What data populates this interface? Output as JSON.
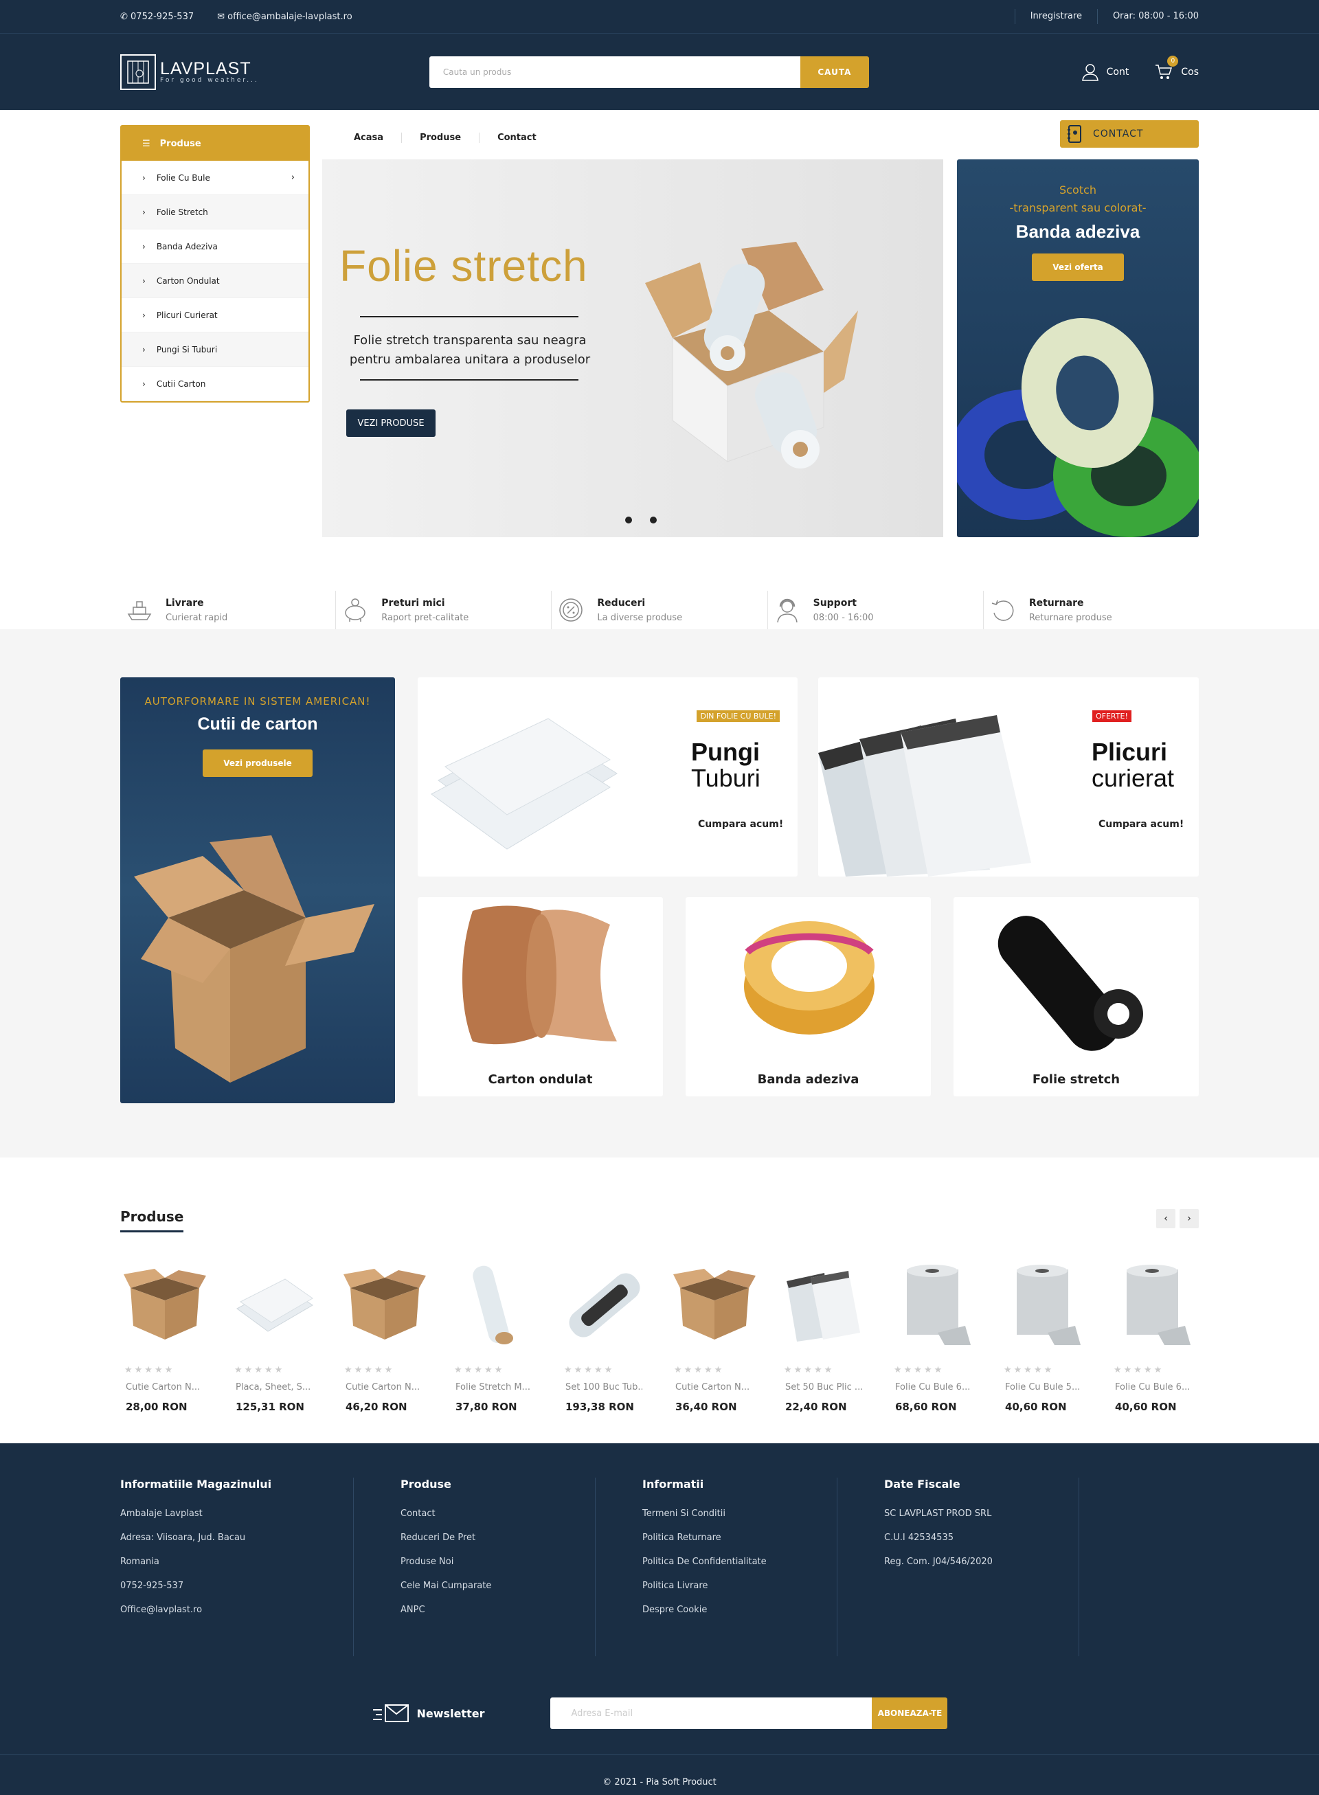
{
  "topbar": {
    "phone": "0752-925-537",
    "email": "office@ambalaje-lavplast.ro",
    "register": "Inregistrare",
    "hours": "Orar: 08:00 - 16:00"
  },
  "header": {
    "logo_title": "LAVPLAST",
    "logo_tagline": "For good weather...",
    "search_placeholder": "Cauta un produs",
    "search_button": "CAUTA",
    "account": "Cont",
    "cart": "Cos",
    "cart_count": "0"
  },
  "categories": {
    "title": "Produse",
    "items": [
      {
        "label": "Folie Cu Bule"
      },
      {
        "label": "Folie Stretch"
      },
      {
        "label": "Banda Adeziva"
      },
      {
        "label": "Carton Ondulat"
      },
      {
        "label": "Plicuri Curierat"
      },
      {
        "label": "Pungi Si Tuburi"
      },
      {
        "label": "Cutii Carton"
      }
    ]
  },
  "nav": {
    "items": [
      "Acasa",
      "Produse",
      "Contact"
    ],
    "contact_button": "CONTACT"
  },
  "hero": {
    "title": "Folie stretch",
    "text": "Folie stretch transparenta sau neagra pentru ambalarea unitara a produselor",
    "button": "VEZI PRODUSE"
  },
  "promo": {
    "line1": "Scotch",
    "line2": "-transparent sau colorat-",
    "title": "Banda adeziva",
    "button": "Vezi oferta"
  },
  "features": [
    {
      "title": "Livrare",
      "sub": "Curierat rapid",
      "icon": "ship-icon"
    },
    {
      "title": "Preturi mici",
      "sub": "Raport pret-calitate",
      "icon": "piggy-bank-icon"
    },
    {
      "title": "Reduceri",
      "sub": "La diverse produse",
      "icon": "discount-icon"
    },
    {
      "title": "Support",
      "sub": "08:00 - 16:00",
      "icon": "support-icon"
    },
    {
      "title": "Returnare",
      "sub": "Returnare produse",
      "icon": "return-icon"
    }
  ],
  "banners": {
    "big": {
      "sub": "AUTORFORMARE IN SISTEM AMERICAN!",
      "title": "Cutii de carton",
      "button": "Vezi produsele"
    },
    "pungi": {
      "tag": "DIN FOLIE CU BULE!",
      "title1": "Pungi",
      "title2": "Tuburi",
      "buy": "Cumpara acum!"
    },
    "plicuri": {
      "tag": "OFERTE!",
      "title1": "Plicuri",
      "title2": "curierat",
      "buy": "Cumpara acum!"
    },
    "small": [
      "Carton ondulat",
      "Banda adeziva",
      "Folie stretch"
    ]
  },
  "products": {
    "title": "Produse",
    "stars": "★★★★★",
    "items": [
      {
        "name": "Cutie Carton N...",
        "price": "28,00 RON",
        "icon": "box-icon"
      },
      {
        "name": "Placa, Sheet, S...",
        "price": "125,31 RON",
        "icon": "bubble-sheet-icon"
      },
      {
        "name": "Cutie Carton N...",
        "price": "46,20 RON",
        "icon": "box-icon"
      },
      {
        "name": "Folie Stretch M...",
        "price": "37,80 RON",
        "icon": "stretch-roll-icon"
      },
      {
        "name": "Set 100 Buc Tub...",
        "price": "193,38 RON",
        "icon": "bubble-tube-icon"
      },
      {
        "name": "Cutie Carton N...",
        "price": "36,40 RON",
        "icon": "box-icon"
      },
      {
        "name": "Set 50 Buc Plic ...",
        "price": "22,40 RON",
        "icon": "envelope-icon"
      },
      {
        "name": "Folie Cu Bule 6...",
        "price": "68,60 RON",
        "icon": "bubble-roll-icon"
      },
      {
        "name": "Folie Cu Bule 5...",
        "price": "40,60 RON",
        "icon": "bubble-roll-icon"
      },
      {
        "name": "Folie Cu Bule 6...",
        "price": "40,60 RON",
        "icon": "bubble-roll-icon"
      }
    ]
  },
  "footer": {
    "cols": [
      {
        "title": "Informatiile Magazinului",
        "items": [
          "Ambalaje Lavplast",
          "Adresa: Viisoara, Jud. Bacau",
          "Romania",
          "0752-925-537",
          "Office@lavplast.ro"
        ]
      },
      {
        "title": "Produse",
        "items": [
          "Contact",
          "Reduceri De Pret",
          "Produse Noi",
          "Cele Mai Cumparate",
          "ANPC"
        ]
      },
      {
        "title": "Informatii",
        "items": [
          "Termeni Si Conditii",
          "Politica Returnare",
          "Politica De Confidentialitate",
          "Politica Livrare",
          "Despre Cookie"
        ]
      },
      {
        "title": "Date Fiscale",
        "items": [
          "SC LAVPLAST PROD SRL",
          "C.U.I 42534535",
          "Reg. Com. J04/546/2020"
        ]
      }
    ],
    "newsletter": "Newsletter",
    "newsletter_placeholder": "Adresa E-mail",
    "subscribe": "ABONEAZA-TE",
    "copyright": "© 2021 - Pia Soft Product"
  },
  "colors": {
    "navy": "#1a2e44",
    "gold": "#d4a22c"
  }
}
